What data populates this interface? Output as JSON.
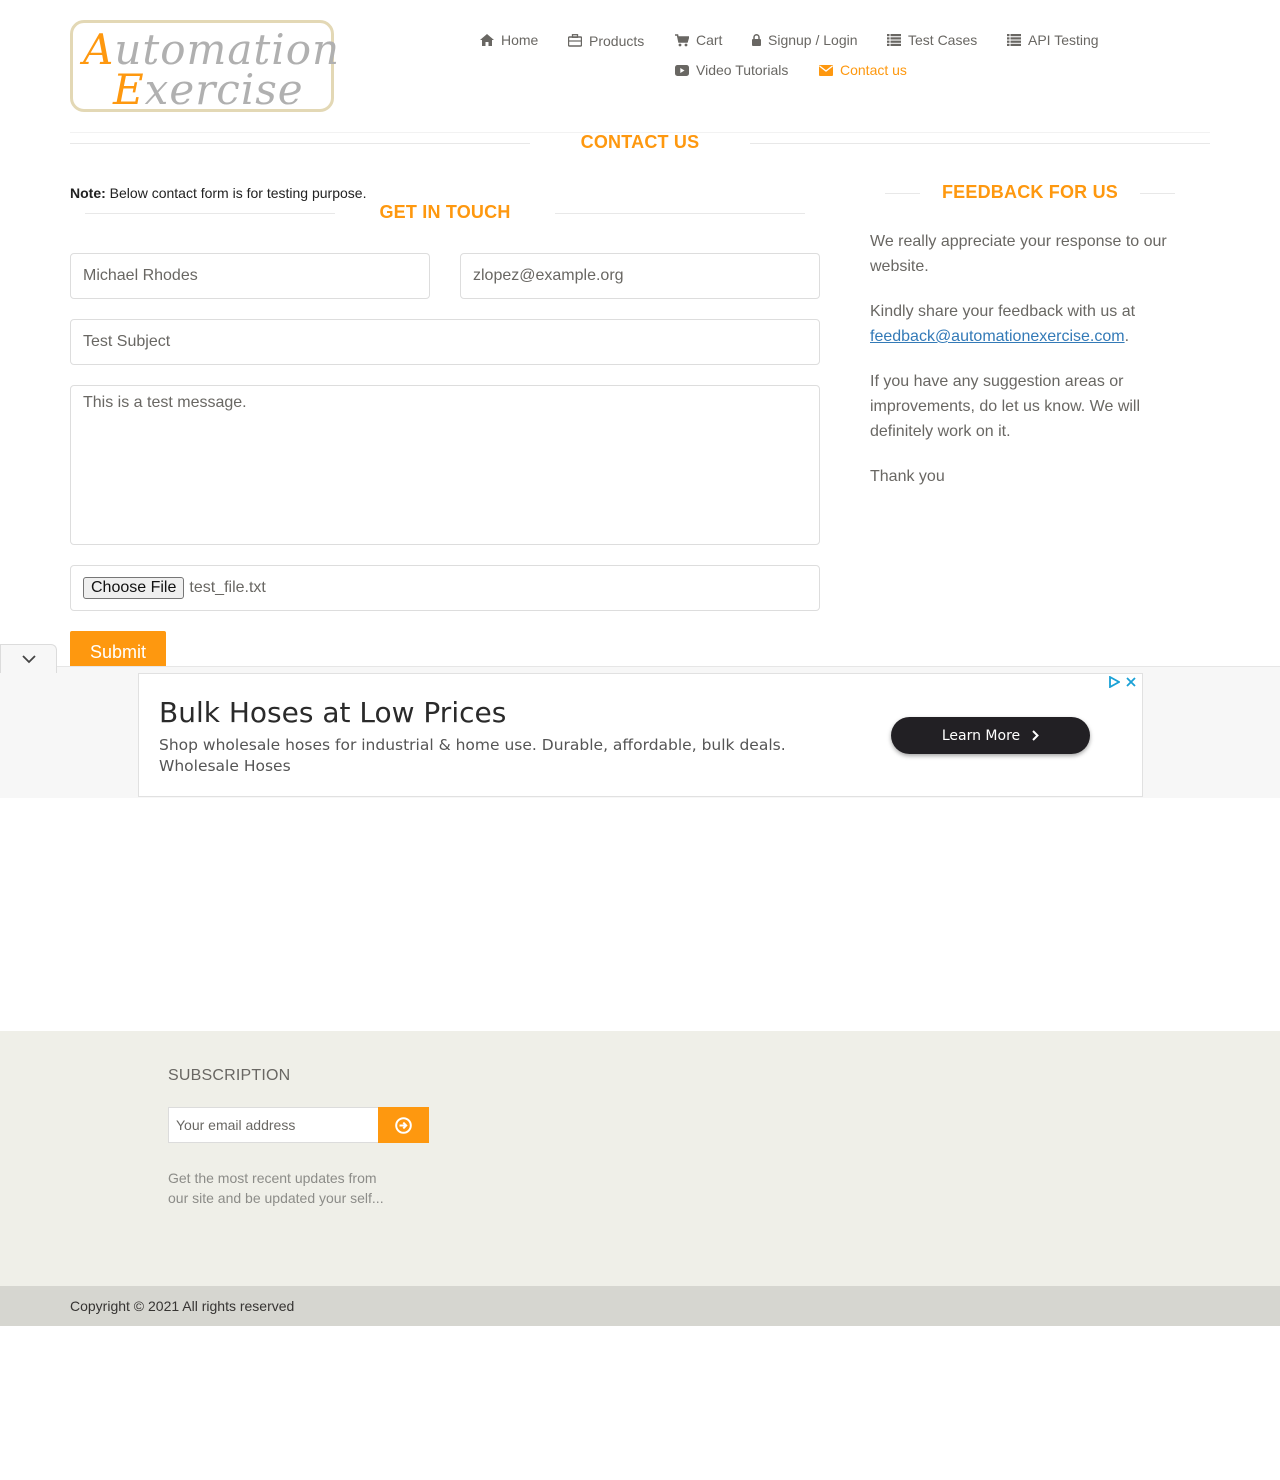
{
  "logo": {
    "line1_cap": "A",
    "line1_rest": "utomation",
    "line2_cap": "E",
    "line2_rest": "xercise"
  },
  "nav": {
    "items": [
      {
        "label": "Home",
        "icon": "home-icon"
      },
      {
        "label": "Products",
        "icon": "briefcase-icon"
      },
      {
        "label": "Cart",
        "icon": "cart-icon"
      },
      {
        "label": "Signup / Login",
        "icon": "lock-icon"
      },
      {
        "label": "Test Cases",
        "icon": "list-icon"
      },
      {
        "label": "API Testing",
        "icon": "list-icon"
      },
      {
        "label": "Video Tutorials",
        "icon": "youtube-icon"
      },
      {
        "label": "Contact us",
        "icon": "envelope-icon",
        "active": true
      }
    ]
  },
  "page_title": "CONTACT US",
  "contact_form": {
    "note_label": "Note:",
    "note_text": " Below contact form is for testing purpose.",
    "title": "GET IN TOUCH",
    "name_value": "Michael Rhodes",
    "email_value": "zlopez@example.org",
    "subject_value": "Test Subject",
    "message_value": "This is a test message.",
    "file_button": "Choose File",
    "file_name": "test_file.txt",
    "submit_label": "Submit"
  },
  "feedback": {
    "title": "FEEDBACK FOR US",
    "p1": "We really appreciate your response to our website.",
    "p2_text": "Kindly share your feedback with us at ",
    "p2_link": "feedback@automationexercise.com",
    "p2_end": ".",
    "p3": "If you have any suggestion areas or improvements, do let us know. We will definitely work on it.",
    "p4": "Thank you"
  },
  "ad": {
    "title": "Bulk Hoses at Low Prices",
    "description": "Shop wholesale hoses for industrial & home use. Durable, affordable, bulk deals. Wholesale Hoses",
    "cta_label": "Learn More"
  },
  "footer": {
    "subscription_title": "SUBSCRIPTION",
    "email_placeholder": "Your email address",
    "subscription_text": "Get the most recent updates from our site and be updated your self...",
    "copyright": "Copyright © 2021 All rights reserved"
  },
  "colors": {
    "accent": "#fe980f",
    "link": "#337ab7",
    "text": "#696763",
    "footer_bg": "#efefe8",
    "footer_bottom_bg": "#d6d6d0"
  }
}
